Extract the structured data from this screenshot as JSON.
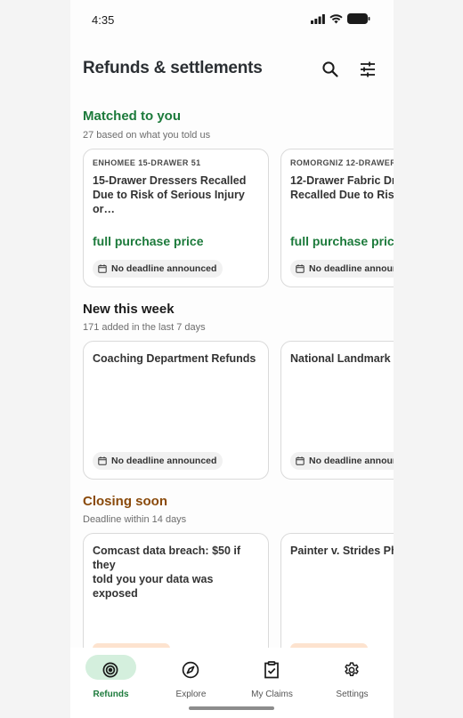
{
  "status": {
    "time": "4:35"
  },
  "header": {
    "title": "Refunds & settlements"
  },
  "sections": [
    {
      "title": "Matched to you",
      "subtitle": "27 based on what you told us",
      "color": "#1c7a3b",
      "cards": [
        {
          "kicker": "ENHOMEE 15-DRAWER 51",
          "title": "15-Drawer Dressers Recalled\nDue to Risk of Serious Injury or…",
          "amount": "full purchase price",
          "chip": "No deadline announced"
        },
        {
          "kicker": "ROMORGNIZ 12-DRAWER",
          "title": "12-Drawer Fabric Dr\nRecalled Due to Risk",
          "amount": "full purchase price",
          "chip": "No deadline announ"
        }
      ]
    },
    {
      "title": "New this week",
      "subtitle": "171 added in the last 7 days",
      "color": "#1b1b1b",
      "cards": [
        {
          "title": "Coaching Department Refunds",
          "chip": "No deadline announced"
        },
        {
          "title": "National Landmark F",
          "chip": "No deadline announ"
        }
      ]
    },
    {
      "title": "Closing soon",
      "subtitle": "Deadline within 14 days",
      "color": "#8a4a0b",
      "cards": [
        {
          "title": "Comcast data breach: $50 if they\ntold you your data was exposed"
        },
        {
          "title": "Painter v. Strides Ph"
        }
      ]
    }
  ],
  "nav": [
    {
      "label": "Refunds",
      "icon": "target-icon",
      "active": true
    },
    {
      "label": "Explore",
      "icon": "compass-icon",
      "active": false
    },
    {
      "label": "My Claims",
      "icon": "clipboard-check-icon",
      "active": false
    },
    {
      "label": "Settings",
      "icon": "gear-icon",
      "active": false
    }
  ],
  "colors": {
    "accent": "#1c7a3b",
    "nav_active_bg": "#d4efdd",
    "closing": "#8a4a0b"
  }
}
